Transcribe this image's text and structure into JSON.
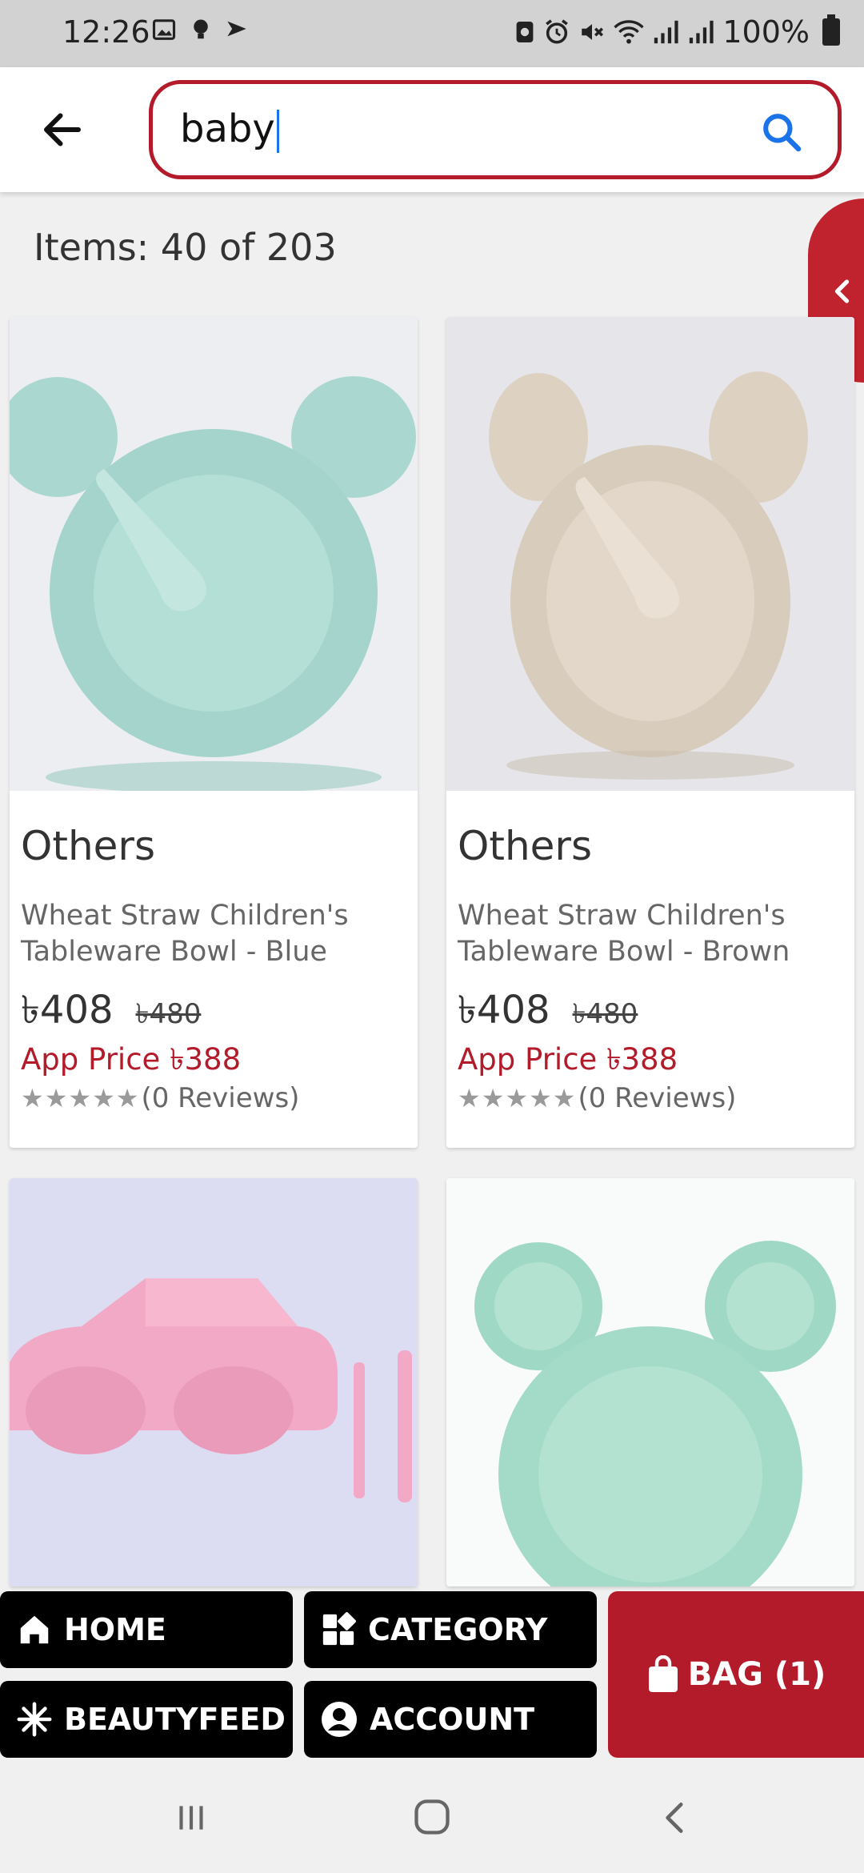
{
  "status_bar": {
    "time": "12:26",
    "battery": "100%",
    "icons": [
      "image-icon",
      "bulb-icon",
      "send-icon",
      "nfc-icon",
      "alarm-icon",
      "mute-icon",
      "wifi-icon",
      "signal-icon",
      "signal-icon",
      "battery-icon"
    ]
  },
  "search": {
    "value": "baby",
    "back_icon": "arrow-left-icon",
    "search_icon": "search-icon"
  },
  "results": {
    "count_text": "Items: 40 of 203"
  },
  "side_tab": {
    "icon": "chevron-left-icon"
  },
  "products": [
    {
      "brand": "Others",
      "name": "Wheat Straw Children's Tableware Bowl - Blue",
      "price": "৳408",
      "old_price": "৳480",
      "app_price": "App Price ৳388",
      "stars": "★★★★★",
      "reviews": "(0 Reviews)"
    },
    {
      "brand": "Others",
      "name": "Wheat Straw Children's Tableware Bowl - Brown",
      "price": "৳408",
      "old_price": "৳480",
      "app_price": "App Price ৳388",
      "stars": "★★★★★",
      "reviews": "(0 Reviews)"
    }
  ],
  "bottom_nav": {
    "home": "HOME",
    "category": "CATEGORY",
    "beautyfeed": "BEAUTYFEED",
    "account": "ACCOUNT",
    "bag": "BAG (1)"
  },
  "colors": {
    "brand_red": "#b31b2b",
    "nav_black": "#000000",
    "search_blue": "#1a73e8"
  }
}
